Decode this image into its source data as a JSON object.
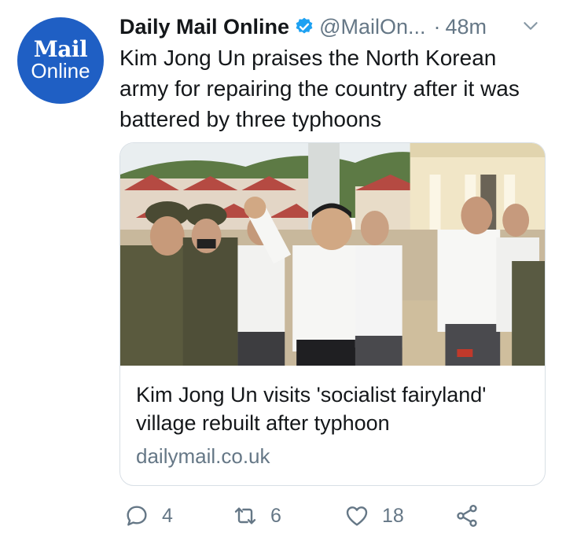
{
  "account": {
    "avatar_line1": "Mail",
    "avatar_line2": "Online",
    "name": "Daily Mail Online",
    "handle": "@MailOn...",
    "separator": "·",
    "time": "48m"
  },
  "tweet": {
    "text": "Kim Jong Un praises the North Korean army for repairing the country after it was battered by three typhoons"
  },
  "card": {
    "title": "Kim Jong Un visits 'socialist fairyland' village rebuilt after typhoon",
    "domain": "dailymail.co.uk"
  },
  "actions": {
    "replies": "4",
    "retweets": "6",
    "likes": "18"
  },
  "colors": {
    "avatar_bg": "#1f5fc4",
    "verified": "#1da1f2",
    "secondary_text": "#657786"
  },
  "icons": [
    "verified-badge-icon",
    "chevron-down-icon",
    "reply-icon",
    "retweet-icon",
    "like-icon",
    "share-icon"
  ]
}
